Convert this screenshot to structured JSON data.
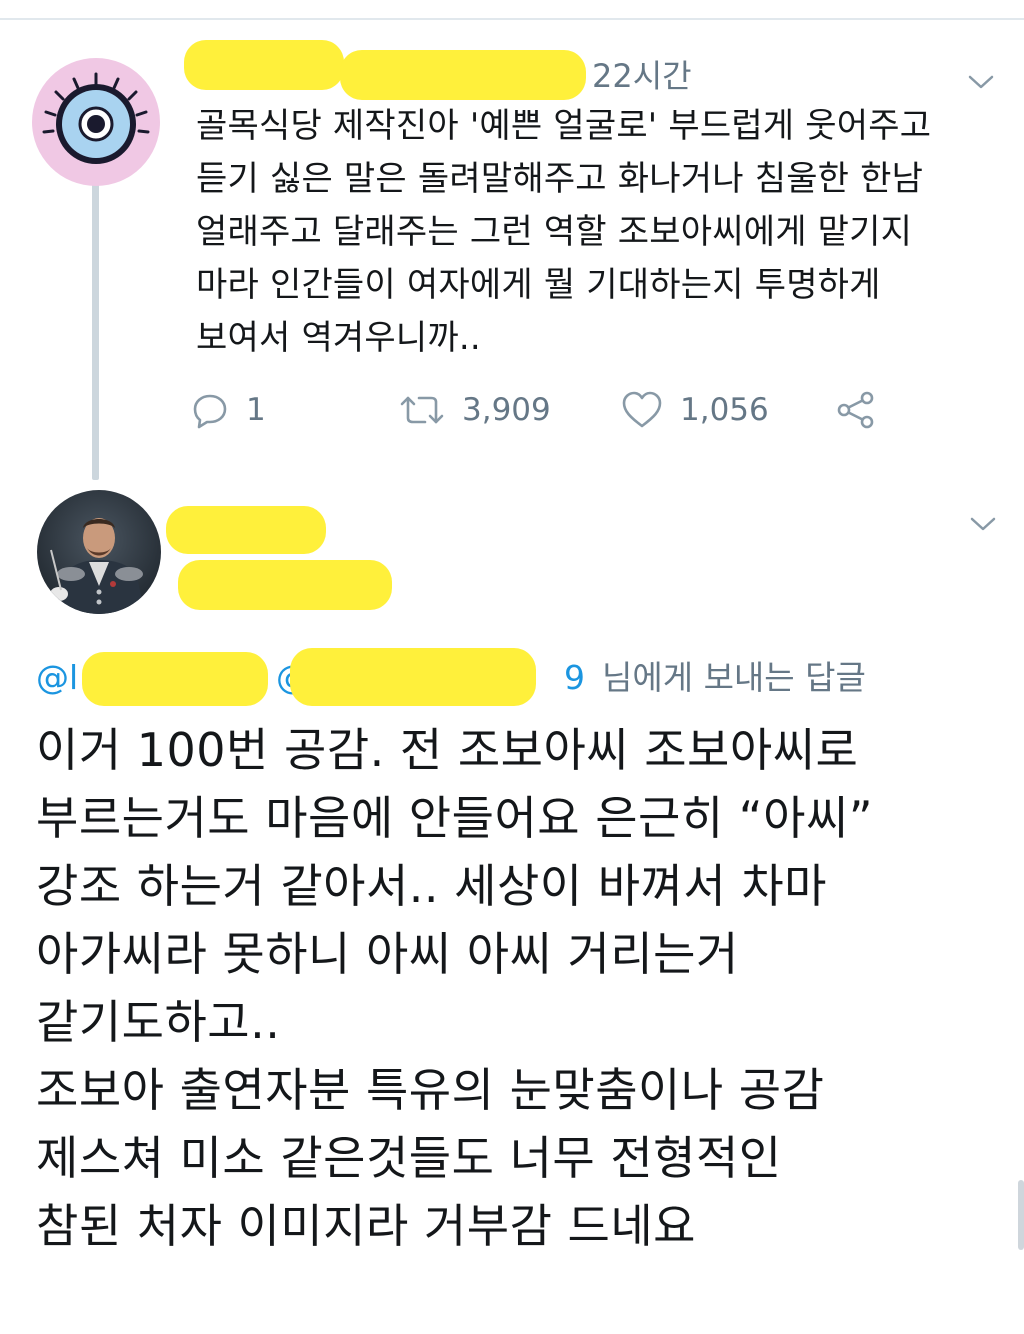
{
  "tweet1": {
    "timestamp": "22시간",
    "body": "골목식당 제작진아 '예쁜 얼굴로' 부드럽게 웃어주고\n듣기 싫은 말은 돌려말해주고 화나거나 침울한 한남\n얼래주고 달래주는 그런 역할 조보아씨에게 맡기지\n마라 인간들이 여자에게 뭘 기대하는지 투명하게\n보여서 역겨우니까..",
    "actions": {
      "reply_icon": "reply-icon",
      "reply_count": "1",
      "retweet_icon": "retweet-icon",
      "retweet_count": "3,909",
      "like_icon": "heart-icon",
      "like_count": "1,056",
      "share_icon": "share-icon"
    }
  },
  "tweet2": {
    "reply_to": {
      "at_prefix": "@l",
      "at_prefix_2": "@",
      "handle_tail": "9",
      "suffix": "님에게 보내는 답글"
    },
    "body": "이거 100번 공감. 전 조보아씨 조보아씨로\n부르는거도 마음에 안들어요 은근히 “아씨”\n강조 하는거 같아서.. 세상이 바껴서 차마\n아가씨라 못하니 아씨 아씨 거리는거\n같기도하고..\n조보아 출연자분 특유의 눈맞춤이나 공감\n제스쳐 미소 같은것들도 너무 전형적인\n참된 처자 이미지라 거부감 드네요"
  },
  "colors": {
    "redaction": "#fff03b",
    "link": "#1b95e0",
    "secondary_text": "#657786",
    "primary_text": "#14171a",
    "thread_line": "#ccd6dd"
  }
}
